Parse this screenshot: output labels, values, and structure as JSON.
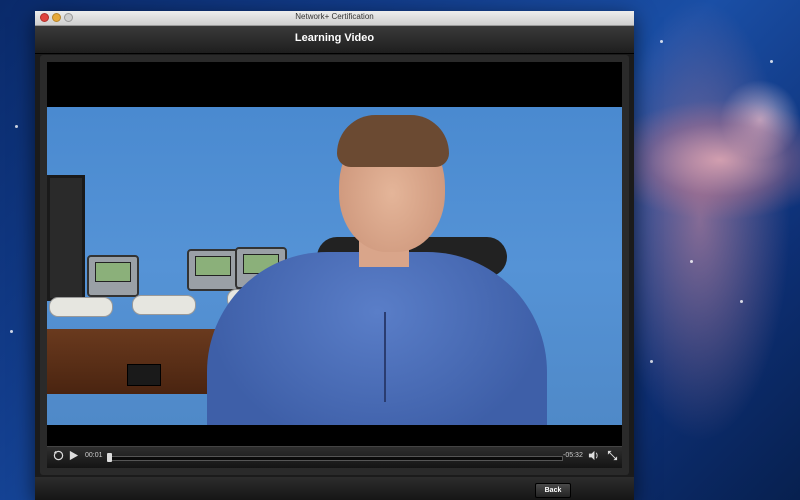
{
  "window": {
    "title": "Network+ Certification"
  },
  "header": {
    "title": "Learning Video"
  },
  "player": {
    "elapsed": "00:01",
    "remaining": "-05:32",
    "progress_fraction": 0.003,
    "controls": {
      "rewind_icon": "replay-30-icon",
      "play_icon": "play-icon",
      "volume_icon": "speaker-icon",
      "fullscreen_icon": "expand-icon"
    }
  },
  "footer": {
    "back_label": "Back"
  },
  "colors": {
    "header_bg": "#2a2a2a",
    "accent": "#ffffff"
  }
}
